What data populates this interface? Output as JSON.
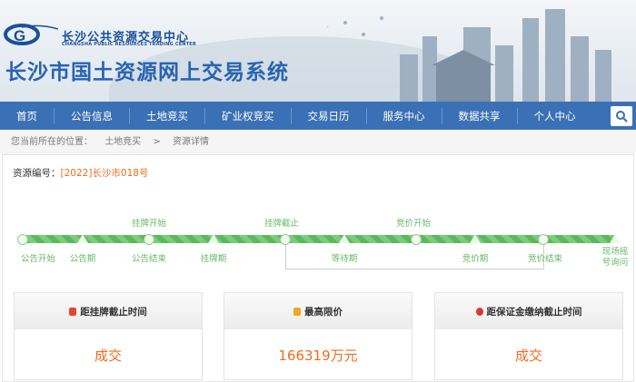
{
  "header": {
    "logo_cn": "长沙公共资源交易中心",
    "logo_en": "CHANGSHA PUBLIC RESOURCES TRADING CENTER",
    "system_title": "长沙市国土资源网上交易系统"
  },
  "nav": {
    "items": [
      "首页",
      "公告信息",
      "土地竞买",
      "矿业权竞买",
      "交易日历",
      "服务中心",
      "数据共享",
      "个人中心"
    ]
  },
  "breadcrumb": {
    "prefix": "您当前所在的位置：",
    "items": [
      "土地竞买",
      ">",
      "资源详情"
    ]
  },
  "resource": {
    "label": "资源编号：",
    "value": "[2022]长沙市018号"
  },
  "timeline": {
    "top_labels": [
      "挂牌开始",
      "挂牌截止",
      "竞价开始"
    ],
    "bottom_labels": [
      "公告开始",
      "公告期",
      "公告结束",
      "挂牌期",
      "等待期",
      "竞价期",
      "竞价结束",
      "现场摇号询问"
    ]
  },
  "cards": [
    {
      "title": "距挂牌截止时间",
      "value": "成交",
      "icon": "clock-icon"
    },
    {
      "title": "最高限价",
      "value": "166319万元",
      "icon": "coins-icon"
    },
    {
      "title": "距保证金缴纳截止时间",
      "value": "成交",
      "icon": "alarm-icon"
    }
  ],
  "colors": {
    "nav": "#3a70b5",
    "accent": "#f06b1e",
    "timeline": "#5cb85c"
  }
}
